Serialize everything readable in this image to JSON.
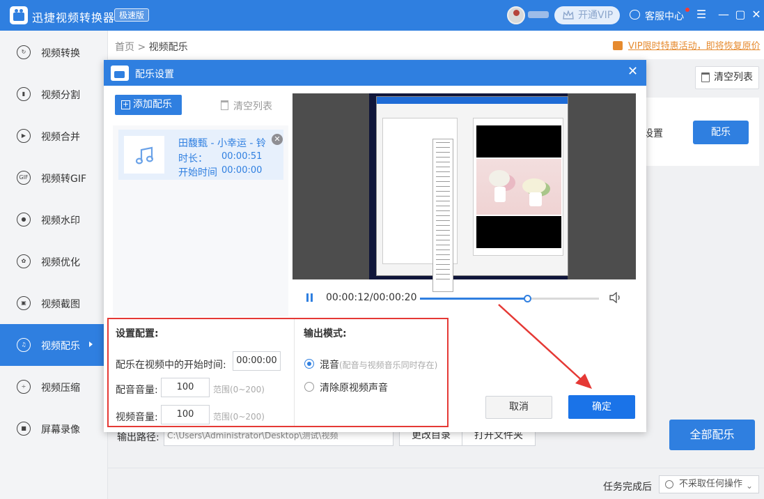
{
  "app": {
    "title": "迅捷视频转换器",
    "edition": "极速版",
    "vip_label": "开通VIP",
    "service_label": "客服中心",
    "window_controls": [
      "menu-icon",
      "minimize-icon",
      "maximize-icon",
      "close-icon"
    ]
  },
  "sidebar": {
    "items": [
      {
        "label": "视频转换",
        "icon": "convert-icon",
        "glyph": "↻"
      },
      {
        "label": "视频分割",
        "icon": "split-icon",
        "glyph": "▮"
      },
      {
        "label": "视频合并",
        "icon": "merge-icon",
        "glyph": "▶"
      },
      {
        "label": "视频转GIF",
        "icon": "gif-icon",
        "glyph": "GIF"
      },
      {
        "label": "视频水印",
        "icon": "watermark-icon",
        "glyph": "●"
      },
      {
        "label": "视频优化",
        "icon": "optimize-icon",
        "glyph": "✿"
      },
      {
        "label": "视频截图",
        "icon": "screenshot-icon",
        "glyph": "▣"
      },
      {
        "label": "视频配乐",
        "icon": "music-icon",
        "glyph": "♫",
        "active": true
      },
      {
        "label": "视频压缩",
        "icon": "compress-icon",
        "glyph": "÷"
      },
      {
        "label": "屏幕录像",
        "icon": "record-icon",
        "glyph": "■"
      }
    ]
  },
  "breadcrumb": {
    "home": "首页",
    "separator": ">",
    "current": "视频配乐"
  },
  "promo": {
    "text": "VIP限时特惠活动，即将恢复原价"
  },
  "main": {
    "clear_list": "清空列表",
    "settings_partial": "设置",
    "music_button": "配乐",
    "output_label": "输出路径:",
    "output_path": "C:\\Users\\Administrator\\Desktop\\测试\\视频",
    "change_dir": "更改目录",
    "open_folder": "打开文件夹",
    "all_music": "全部配乐",
    "after_task_label": "任务完成后",
    "after_task_value": "不采取任何操作"
  },
  "dialog": {
    "title": "配乐设置",
    "add_music": "添加配乐",
    "clear_list": "清空列表",
    "music_item": {
      "name": "田馥甄 - 小幸运 - 铃",
      "duration_label": "时长：",
      "duration": "00:00:51",
      "start_label": "开始时间",
      "start": "00:00:00"
    },
    "player": {
      "time": "00:00:12/00:00:20",
      "progress": 0.6
    },
    "settings": {
      "title": "设置配置:",
      "start_time_label": "配乐在视频中的开始时间:",
      "start_time_value": "00:00:00",
      "music_volume_label": "配音音量:",
      "music_volume_value": "100",
      "video_volume_label": "视频音量:",
      "video_volume_value": "100",
      "range_hint": "范围(0~200)"
    },
    "output_mode": {
      "title": "输出模式:",
      "option_mix": "混音",
      "option_mix_hint": "(配音与视频音乐同时存在)",
      "option_clear": "清除原视频声音",
      "selected": "mix"
    },
    "cancel": "取消",
    "confirm": "确定"
  },
  "colors": {
    "accent": "#2f7fe0",
    "highlight_border": "#e53935",
    "promo": "#e68a2e"
  }
}
